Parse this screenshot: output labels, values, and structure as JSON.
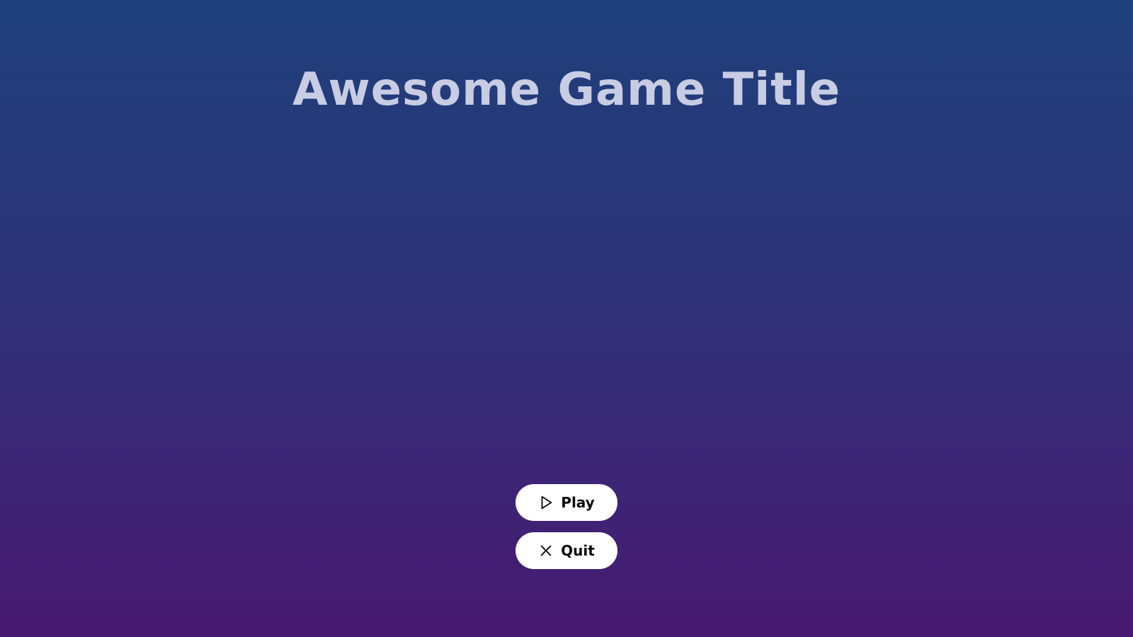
{
  "game": {
    "title": "Awesome Game Title"
  },
  "menu": {
    "play": {
      "label": "Play",
      "icon": "play-icon"
    },
    "quit": {
      "label": "Quit",
      "icon": "close-icon"
    }
  },
  "colors": {
    "background_top": "#1e407a",
    "background_bottom": "#481a72",
    "title": "#c8cde3",
    "button_bg": "#ffffff",
    "button_text": "#0a0a0a"
  }
}
